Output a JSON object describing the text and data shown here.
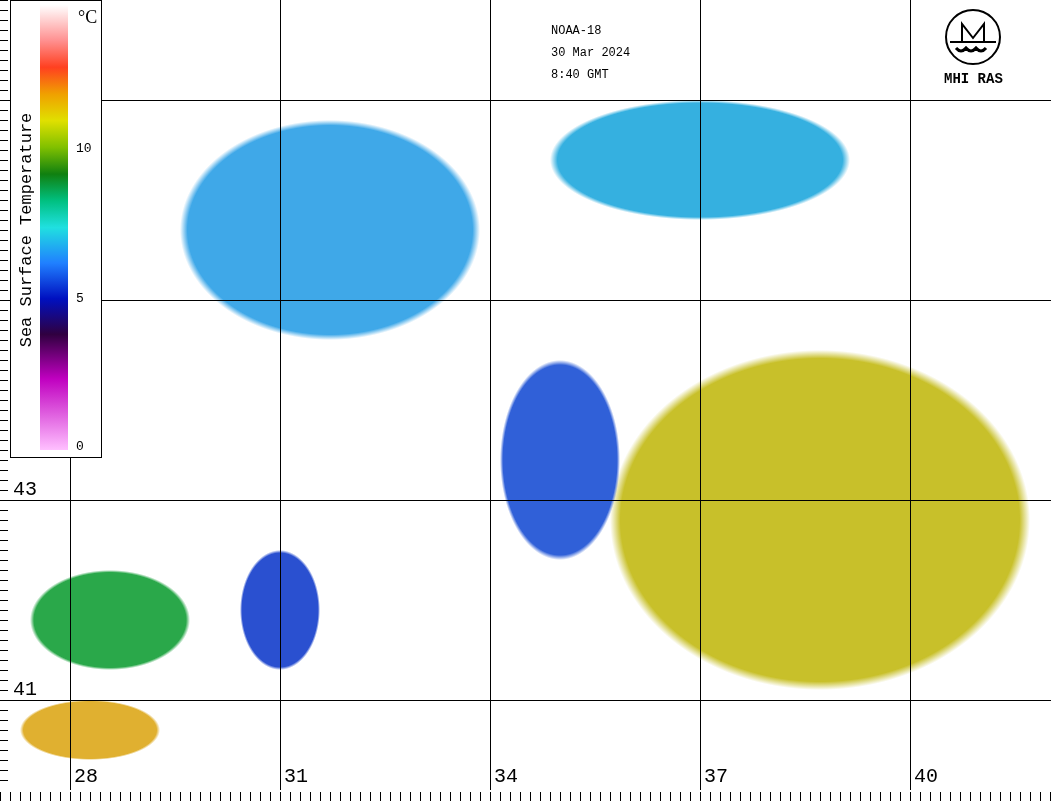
{
  "colorbar": {
    "title": "Sea Surface Temperature",
    "unit": "°C",
    "ticks": [
      "10",
      "5",
      "0"
    ]
  },
  "caption": {
    "satellite": "NOAA-18",
    "date": "30 Mar 2024",
    "time": "8:40 GMT"
  },
  "logo": {
    "text": "MHI RAS"
  },
  "grid": {
    "latitudes": [
      "43",
      "41"
    ],
    "longitudes": [
      "28",
      "31",
      "34",
      "37",
      "40"
    ]
  }
}
